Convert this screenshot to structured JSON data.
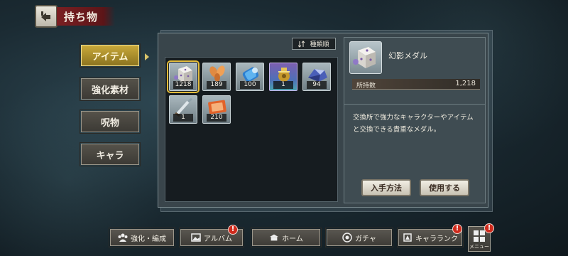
{
  "header": {
    "title": "持ち物"
  },
  "tabs": [
    {
      "label": "アイテム",
      "active": true
    },
    {
      "label": "強化素材",
      "active": false
    },
    {
      "label": "呪物",
      "active": false
    },
    {
      "label": "キャラ",
      "active": false
    }
  ],
  "sort": {
    "label": "種類順"
  },
  "items": [
    {
      "icon": "dice-medal-icon",
      "count": "1218",
      "selected": true
    },
    {
      "icon": "leaf-icon",
      "count": "189"
    },
    {
      "icon": "blue-scroll-icon",
      "count": "100"
    },
    {
      "icon": "golden-pot-icon",
      "count": "1",
      "rare": true
    },
    {
      "icon": "crystal-ore-icon",
      "count": "94"
    },
    {
      "icon": "broken-sword-icon",
      "count": "1"
    },
    {
      "icon": "orange-ticket-icon",
      "count": "210"
    }
  ],
  "detail": {
    "name": "幻影メダル",
    "stock_label": "所持数",
    "stock_value": "1,218",
    "description_line1": "交換所で強力なキャラクターやアイテム",
    "description_line2": "と交換できる貴重なメダル。",
    "how_to_get": "入手方法",
    "use": "使用する"
  },
  "nav": {
    "enhance": "強化・編成",
    "album": "アルバム",
    "home": "ホーム",
    "gacha": "ガチャ",
    "chara_rank": "キャラランク",
    "menu": "メニュー",
    "badge": "!"
  },
  "colors": {
    "accent_gold": "#c9a93a",
    "title_red": "#7a1f22",
    "badge_red": "#cf2a1c"
  }
}
